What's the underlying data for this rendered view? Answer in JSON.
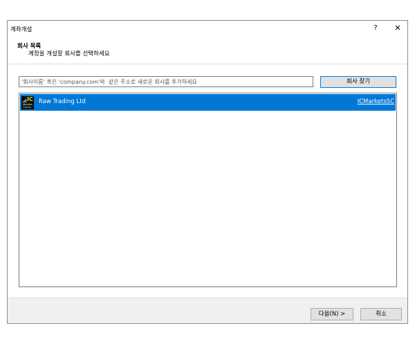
{
  "window": {
    "title": "계좌개설",
    "help_label": "?",
    "close_label": "✕"
  },
  "header": {
    "title": "회사 목록",
    "subtitle": "계정을 개설할 회사를 선택하세요"
  },
  "search": {
    "placeholder": "'회사이름' 혹은 'company.com'와  같은 주소로 새로운 회사를 추가하세요",
    "value": "",
    "find_button_label": "회사 찾기"
  },
  "companies": [
    {
      "name": "Raw Trading Ltd",
      "server": "ICMarketsSC",
      "logo": {
        "icon": "icmarkets-logo",
        "ic": "IC",
        "markets": "Markets",
        "global": "Global"
      },
      "selected": true
    }
  ],
  "footer": {
    "next_label": "다음(N) >",
    "cancel_label": "취소"
  },
  "colors": {
    "selection": "#0078d7",
    "logo_accent": "#c6e23b"
  }
}
